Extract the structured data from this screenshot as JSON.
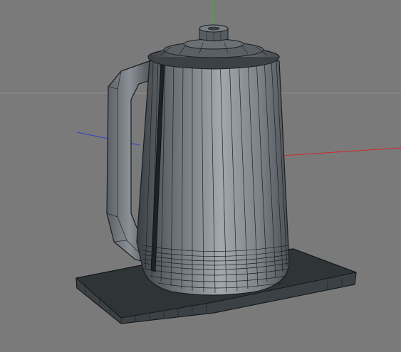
{
  "viewport": {
    "background": "#7a7a7a",
    "shading_mode": "gouraud-lines",
    "axis_colors": {
      "x": "#d12a2a",
      "y": "#3fb13f",
      "z": "#2b3fd0"
    },
    "horizon_color": "#8e8e8e"
  },
  "model": {
    "object": "kettle-on-base",
    "body_fill": "#4a4f53",
    "body_highlight": "#9aa0a4",
    "wire_color": "#1a1d20",
    "base_fill": "#2f3437"
  }
}
